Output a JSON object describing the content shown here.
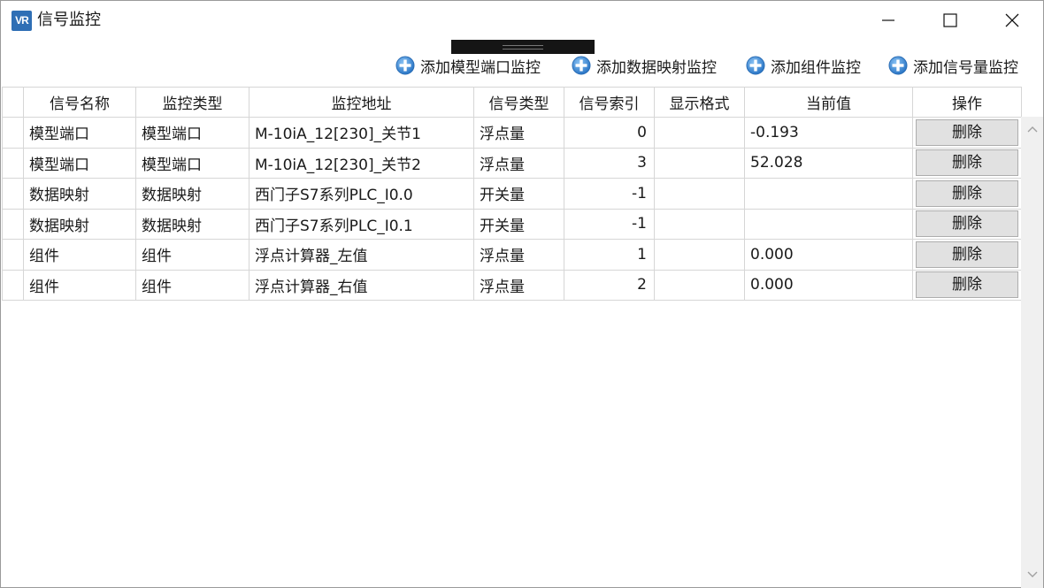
{
  "window": {
    "title": "信号监控",
    "app_icon_text": "VR",
    "app_icon_color": "#2f6fb5"
  },
  "toolbar": {
    "add_model_port": "添加模型端口监控",
    "add_data_map": "添加数据映射监控",
    "add_component": "添加组件监控",
    "add_signal": "添加信号量监控"
  },
  "table": {
    "headers": [
      "信号名称",
      "监控类型",
      "监控地址",
      "信号类型",
      "信号索引",
      "显示格式",
      "当前值",
      "操作"
    ],
    "rows": [
      {
        "name": "模型端口",
        "type": "模型端口",
        "address": "M-10iA_12[230]_关节1",
        "signal_type": "浮点量",
        "index": "0",
        "format": "",
        "value": "-0.193",
        "action": "删除"
      },
      {
        "name": "模型端口",
        "type": "模型端口",
        "address": "M-10iA_12[230]_关节2",
        "signal_type": "浮点量",
        "index": "3",
        "format": "",
        "value": "52.028",
        "action": "删除"
      },
      {
        "name": "数据映射",
        "type": "数据映射",
        "address": "西门子S7系列PLC_I0.0",
        "signal_type": "开关量",
        "index": "-1",
        "format": "",
        "value": "",
        "action": "删除"
      },
      {
        "name": "数据映射",
        "type": "数据映射",
        "address": "西门子S7系列PLC_I0.1",
        "signal_type": "开关量",
        "index": "-1",
        "format": "",
        "value": "",
        "action": "删除"
      },
      {
        "name": "组件",
        "type": "组件",
        "address": "浮点计算器_左值",
        "signal_type": "浮点量",
        "index": "1",
        "format": "",
        "value": "0.000",
        "action": "删除"
      },
      {
        "name": "组件",
        "type": "组件",
        "address": "浮点计算器_右值",
        "signal_type": "浮点量",
        "index": "2",
        "format": "",
        "value": "0.000",
        "action": "删除"
      }
    ]
  },
  "colors": {
    "accent_icon": "#3a86d4",
    "button_bg": "#e1e1e1"
  }
}
